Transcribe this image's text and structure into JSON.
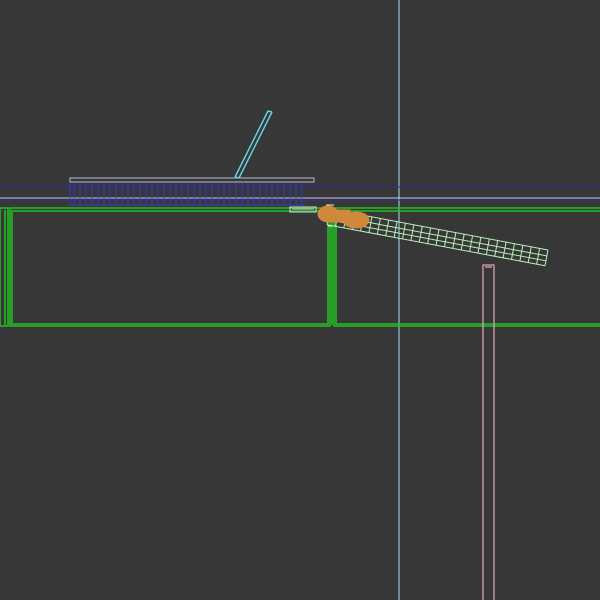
{
  "viewport": {
    "kind": "3d-wireframe-viewport",
    "background_color": "#373737"
  },
  "colors": {
    "vertical_axis": "#a8dff0",
    "horizontal_guide_blue": "#2e2ea8",
    "horizontal_guide_light": "#c9c9d6",
    "table_frame": "#22c022",
    "angled_strut": "#b9f0b9",
    "pivot_joint": "#d2883a",
    "blue_grid_frame": "#3a3ac8",
    "cyan_arm": "#67d2dc",
    "pink_post": "#e6a7c2",
    "light_rail": "#d8d8d8"
  },
  "objects": [
    {
      "name": "table-frame",
      "label": ""
    },
    {
      "name": "angled-strut",
      "label": ""
    },
    {
      "name": "pivot-joint",
      "label": ""
    },
    {
      "name": "blue-grid-frame",
      "label": ""
    },
    {
      "name": "cyan-arm",
      "label": ""
    },
    {
      "name": "pink-post",
      "label": ""
    }
  ]
}
